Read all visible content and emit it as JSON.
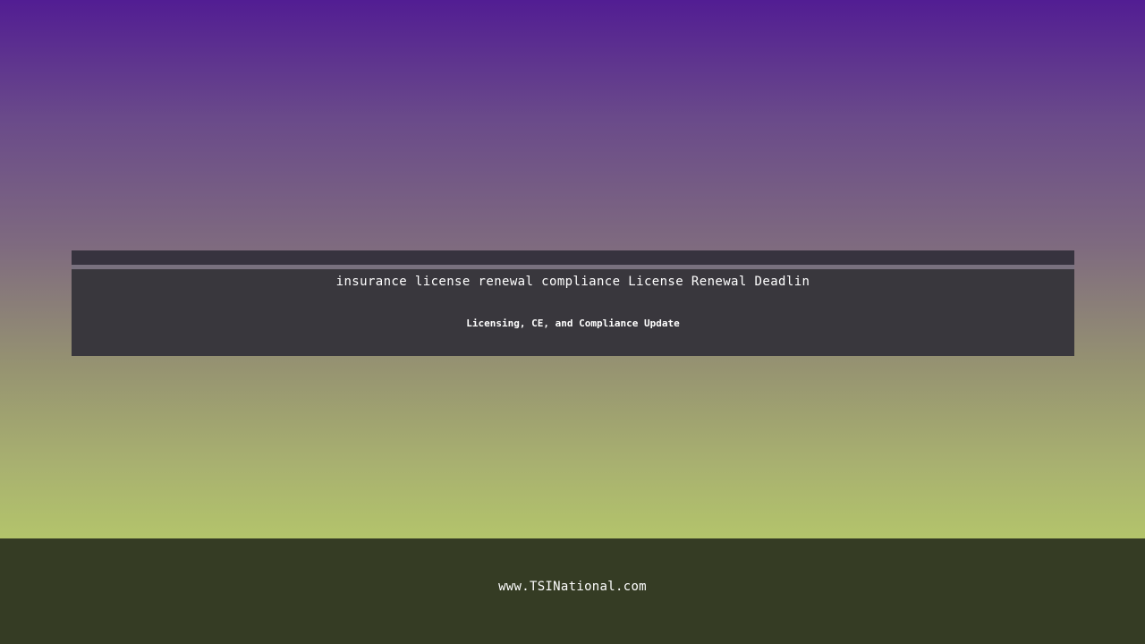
{
  "banner": {
    "title": "insurance license renewal compliance License Renewal Deadlin",
    "subtitle": "Licensing, CE, and Compliance Update"
  },
  "footer": {
    "url": "www.TSINational.com"
  },
  "colors": {
    "gradient_top": "#521d93",
    "gradient_bottom": "#b3c46b",
    "banner_bg": "#39373d",
    "footer_bg": "#353c24",
    "text": "#ffffff"
  }
}
